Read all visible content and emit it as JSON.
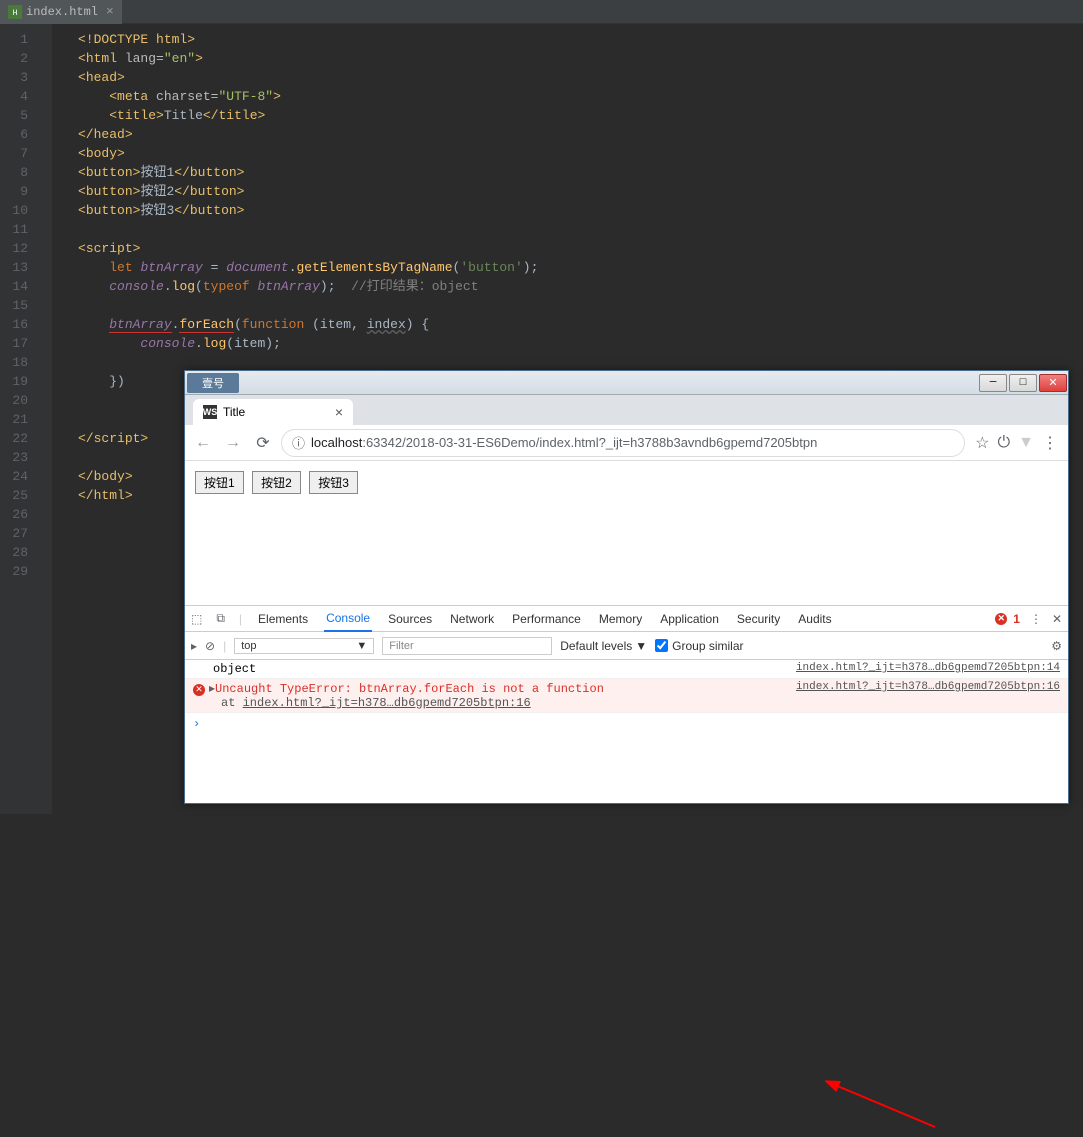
{
  "ide": {
    "tab_filename": "index.html",
    "line_numbers": [
      "1",
      "2",
      "3",
      "4",
      "5",
      "6",
      "7",
      "8",
      "9",
      "10",
      "11",
      "12",
      "13",
      "14",
      "15",
      "16",
      "17",
      "18",
      "19",
      "20",
      "21",
      "22",
      "23",
      "24",
      "25",
      "26",
      "27",
      "28",
      "29"
    ],
    "code": {
      "l1_doctype": "<!DOCTYPE html>",
      "l2_open": "<",
      "l2_tag": "html",
      "l2_attr": " lang=",
      "l2_val": "\"en\"",
      "l2_close": ">",
      "l3_open": "<",
      "l3_tag": "head",
      "l3_close": ">",
      "l4_open": "<",
      "l4_tag": "meta",
      "l4_attr": " charset=",
      "l4_val": "\"UTF-8\"",
      "l4_close": ">",
      "l5_open": "<",
      "l5_tag": "title",
      "l5_close": ">",
      "l5_text": "Title",
      "l5_eopen": "</",
      "l5_etag": "title",
      "l5_eclose": ">",
      "l6_open": "</",
      "l6_tag": "head",
      "l6_close": ">",
      "l7_open": "<",
      "l7_tag": "body",
      "l7_close": ">",
      "l8_open": "<",
      "l8_tag": "button",
      "l8_close": ">",
      "l8_text": "按钮1",
      "l8_eopen": "</",
      "l8_etag": "button",
      "l8_eclose": ">",
      "l9_open": "<",
      "l9_tag": "button",
      "l9_close": ">",
      "l9_text": "按钮2",
      "l9_eopen": "</",
      "l9_etag": "button",
      "l9_eclose": ">",
      "l10_open": "<",
      "l10_tag": "button",
      "l10_close": ">",
      "l10_text": "按钮3",
      "l10_eopen": "</",
      "l10_etag": "button",
      "l10_eclose": ">",
      "l12_open": "<",
      "l12_tag": "script",
      "l12_close": ">",
      "l13_kw": "let ",
      "l13_var": "btnArray",
      "l13_eq": " = ",
      "l13_doc": "document",
      "l13_dot": ".",
      "l13_fn": "getElementsByTagName",
      "l13_paren": "(",
      "l13_str": "'button'",
      "l13_end": ");",
      "l14_con": "console",
      "l14_dot": ".",
      "l14_log": "log",
      "l14_paren": "(",
      "l14_typeof": "typeof ",
      "l14_var": "btnArray",
      "l14_end": ");  ",
      "l14_comment": "//打印结果：object",
      "l16_var": "btnArray",
      "l16_dot": ".",
      "l16_fe": "forEach",
      "l16_paren": "(",
      "l16_fn": "function ",
      "l16_paren2": "(",
      "l16_p1": "item",
      "l16_comma": ", ",
      "l16_p2": "index",
      "l16_paren3": ") {",
      "l17_con": "console",
      "l17_dot": ".",
      "l17_log": "log",
      "l17_paren": "(",
      "l17_var": "item",
      "l17_end": ");",
      "l19_close": "})",
      "l22_open": "</",
      "l22_tag": "script",
      "l22_close": ">",
      "l24_open": "</",
      "l24_tag": "body",
      "l24_close": ">",
      "l25_open": "</",
      "l25_tag": "html",
      "l25_close": ">"
    }
  },
  "browser": {
    "win_title_badge": "壹号",
    "tab_title": "Title",
    "url_host": "localhost",
    "url_path": ":63342/2018-03-31-ES6Demo/index.html?_ijt=h3788b3avndb6gpemd7205btpn",
    "buttons": [
      "按钮1",
      "按钮2",
      "按钮3"
    ]
  },
  "devtools": {
    "tabs": [
      "Elements",
      "Console",
      "Sources",
      "Network",
      "Performance",
      "Memory",
      "Application",
      "Security",
      "Audits"
    ],
    "active_tab": "Console",
    "error_count": "1",
    "context": "top",
    "filter_placeholder": "Filter",
    "level_label": "Default levels",
    "group_similar": "Group similar",
    "rows": {
      "obj_msg": "object",
      "obj_src": "index.html?_ijt=h378…db6gpemd7205btpn:14",
      "err_msg": "Uncaught TypeError: btnArray.forEach is not a function",
      "err_at": "at ",
      "err_at_link": "index.html?_ijt=h378…db6gpemd7205btpn:16",
      "err_src": "index.html?_ijt=h378…db6gpemd7205btpn:16"
    }
  }
}
